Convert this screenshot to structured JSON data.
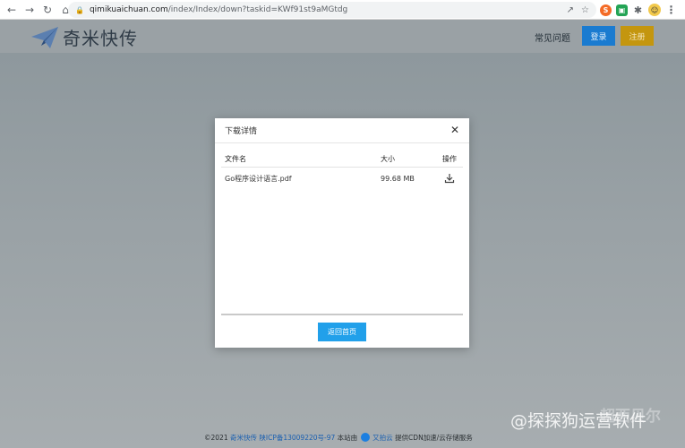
{
  "browser": {
    "url_host": "qimikuaichuan.com",
    "url_path": "/index/Index/down?taskid=KWf91st9aMGtdg",
    "back_icon": "arrow-left-icon",
    "forward_icon": "arrow-right-icon",
    "reload_icon": "reload-icon",
    "home_icon": "home-icon"
  },
  "header": {
    "logo_text": "奇米快传",
    "faq_label": "常见问题",
    "login_label": "登录",
    "register_label": "注册",
    "login_color": "#1a7bd0",
    "register_color": "#c4960f"
  },
  "modal": {
    "title": "下载详情",
    "columns": {
      "name": "文件名",
      "size": "大小",
      "action": "操作"
    },
    "files": [
      {
        "name": "Go程序设计语言.pdf",
        "size": "99.68 MB"
      }
    ],
    "home_button_label": "返回首页",
    "home_button_color": "#21a0ea"
  },
  "footer": {
    "copyright": "©2021",
    "site_name": "奇米快传",
    "icp": "陕ICP备13009220号-97",
    "hosted_by": "本站由",
    "cloud_name": "又拍云",
    "cdn_text": "提供CDN加速/云存储服务"
  },
  "watermark": {
    "text": "@探探狗运营软件",
    "faint_text": "超西贝尔"
  }
}
